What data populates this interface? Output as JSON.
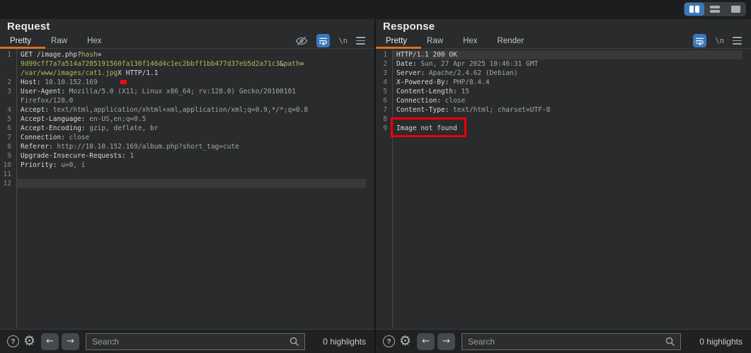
{
  "colors": {
    "accent_orange": "#dd6f1e",
    "accent_blue": "#3a78be",
    "annotation_red": "#ef0000",
    "param_olive": "#b3ba55"
  },
  "chrome": {
    "layout_buttons": [
      "columns-layout",
      "rows-layout",
      "single-pane-layout"
    ],
    "active_layout": "columns-layout"
  },
  "icons": {
    "help": "?",
    "gear": "⚙",
    "prev": "←",
    "next": "→",
    "newline": "\\n"
  },
  "request_panel": {
    "title": "Request",
    "tabs": [
      {
        "label": "Pretty",
        "active": true
      },
      {
        "label": "Raw",
        "active": false
      },
      {
        "label": "Hex",
        "active": false
      }
    ],
    "toolbar_icons": [
      "hide-matches-icon",
      "soft-wrap-icon",
      "newline-icon",
      "menu-icon"
    ],
    "search": {
      "placeholder": "Search",
      "value": ""
    },
    "highlights_label": "0 highlights",
    "lines": [
      {
        "num": 1,
        "rows": [
          [
            {
              "t": "GET /image.php?",
              "c": "w"
            },
            {
              "t": "hash",
              "c": "o"
            },
            {
              "t": "=",
              "c": "w"
            }
          ],
          [
            {
              "t": "9d99cff7a7a514a7285191560fa130f146d4c1ec2bbff1bb477d37eb5d2a71c3",
              "c": "o"
            },
            {
              "t": "&",
              "c": "w"
            },
            {
              "t": "path",
              "c": "o"
            },
            {
              "t": "=",
              "c": "w"
            }
          ],
          [
            {
              "t": "/var/www/images/cat1.jpg",
              "c": "o"
            },
            {
              "t": "X HTTP/1.1",
              "c": "w"
            }
          ]
        ]
      },
      {
        "num": 2,
        "rows": [
          [
            {
              "t": "Host:",
              "c": "w"
            },
            {
              "t": " 10.10.152.169",
              "c": "g"
            }
          ]
        ]
      },
      {
        "num": 3,
        "rows": [
          [
            {
              "t": "User-Agent:",
              "c": "w"
            },
            {
              "t": " Mozilla/5.0 (X11; Linux x86_64; rv:128.0) Gecko/20100101",
              "c": "g"
            }
          ],
          [
            {
              "t": "Firefox/128.0",
              "c": "g"
            }
          ]
        ]
      },
      {
        "num": 4,
        "rows": [
          [
            {
              "t": "Accept:",
              "c": "w"
            },
            {
              "t": " text/html,application/xhtml+xml,application/xml;q=0.9,*/*;q=0.8",
              "c": "g"
            }
          ]
        ]
      },
      {
        "num": 5,
        "rows": [
          [
            {
              "t": "Accept-Language:",
              "c": "w"
            },
            {
              "t": " en-US,en;q=0.5",
              "c": "g"
            }
          ]
        ]
      },
      {
        "num": 6,
        "rows": [
          [
            {
              "t": "Accept-Encoding:",
              "c": "w"
            },
            {
              "t": " gzip, deflate, br",
              "c": "g"
            }
          ]
        ]
      },
      {
        "num": 7,
        "rows": [
          [
            {
              "t": "Connection:",
              "c": "w"
            },
            {
              "t": " close",
              "c": "g"
            }
          ]
        ]
      },
      {
        "num": 8,
        "rows": [
          [
            {
              "t": "Referer:",
              "c": "w"
            },
            {
              "t": " http://10.10.152.169/album.php?short_tag=cute",
              "c": "g"
            }
          ]
        ]
      },
      {
        "num": 9,
        "rows": [
          [
            {
              "t": "Upgrade-Insecure-Requests:",
              "c": "w"
            },
            {
              "t": " 1",
              "c": "g"
            }
          ]
        ]
      },
      {
        "num": 10,
        "rows": [
          [
            {
              "t": "Priority:",
              "c": "w"
            },
            {
              "t": " u=0, i",
              "c": "g"
            }
          ]
        ]
      },
      {
        "num": 11,
        "rows": [
          []
        ]
      },
      {
        "num": 12,
        "hl": true,
        "rows": [
          []
        ]
      }
    ]
  },
  "response_panel": {
    "title": "Response",
    "tabs": [
      {
        "label": "Pretty",
        "active": true
      },
      {
        "label": "Raw",
        "active": false
      },
      {
        "label": "Hex",
        "active": false
      },
      {
        "label": "Render",
        "active": false
      }
    ],
    "toolbar_icons": [
      "soft-wrap-icon",
      "newline-icon",
      "menu-icon"
    ],
    "search": {
      "placeholder": "Search",
      "value": ""
    },
    "highlights_label": "0 highlights",
    "annotation": {
      "type": "red-box",
      "target": "Image not found"
    },
    "lines": [
      {
        "num": 1,
        "hl": true,
        "rows": [
          [
            {
              "t": "HTTP/1.1 200 OK",
              "c": "w"
            }
          ]
        ]
      },
      {
        "num": 2,
        "rows": [
          [
            {
              "t": "Date:",
              "c": "w"
            },
            {
              "t": " Sun, 27 Apr 2025 10:46:31 GMT",
              "c": "g"
            }
          ]
        ]
      },
      {
        "num": 3,
        "rows": [
          [
            {
              "t": "Server:",
              "c": "w"
            },
            {
              "t": " Apache/2.4.62 (Debian)",
              "c": "g"
            }
          ]
        ]
      },
      {
        "num": 4,
        "rows": [
          [
            {
              "t": "X-Powered-By:",
              "c": "w"
            },
            {
              "t": " PHP/8.4.4",
              "c": "g"
            }
          ]
        ]
      },
      {
        "num": 5,
        "rows": [
          [
            {
              "t": "Content-Length:",
              "c": "w"
            },
            {
              "t": " 15",
              "c": "g"
            }
          ]
        ]
      },
      {
        "num": 6,
        "rows": [
          [
            {
              "t": "Connection:",
              "c": "w"
            },
            {
              "t": " close",
              "c": "g"
            }
          ]
        ]
      },
      {
        "num": 7,
        "rows": [
          [
            {
              "t": "Content-Type:",
              "c": "w"
            },
            {
              "t": " text/html; charset=UTF-8",
              "c": "g"
            }
          ]
        ]
      },
      {
        "num": 8,
        "rows": [
          []
        ]
      },
      {
        "num": 9,
        "rows": [
          [
            {
              "t": "Image not found",
              "c": "w"
            }
          ]
        ]
      }
    ]
  }
}
